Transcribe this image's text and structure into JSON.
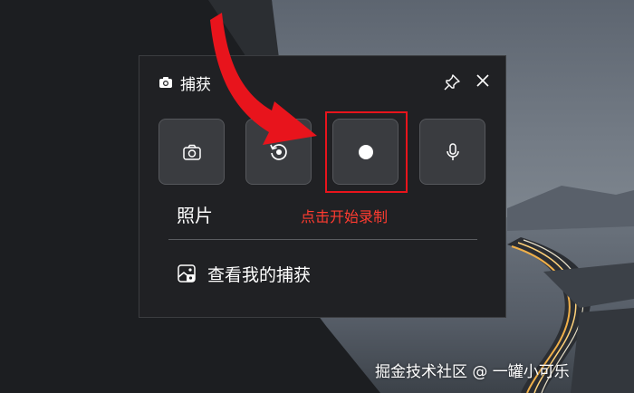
{
  "panel": {
    "title": "捕获",
    "title_icon": "camera-icon",
    "pin_icon": "pin-icon",
    "close_icon": "close-icon"
  },
  "tools": [
    {
      "name": "photo",
      "icon": "camera-icon"
    },
    {
      "name": "replay",
      "icon": "replay-icon"
    },
    {
      "name": "record",
      "icon": "record-icon"
    },
    {
      "name": "microphone",
      "icon": "microphone-icon"
    }
  ],
  "labels": {
    "photo": "照片",
    "record_hint": "点击开始录制"
  },
  "gallery": {
    "label": "查看我的捕获",
    "icon": "gallery-icon"
  },
  "annotation": {
    "arrow_color": "#e8141c",
    "highlight_color": "#e8141c"
  },
  "watermark": "掘金技术社区 @ 一罐小可乐"
}
